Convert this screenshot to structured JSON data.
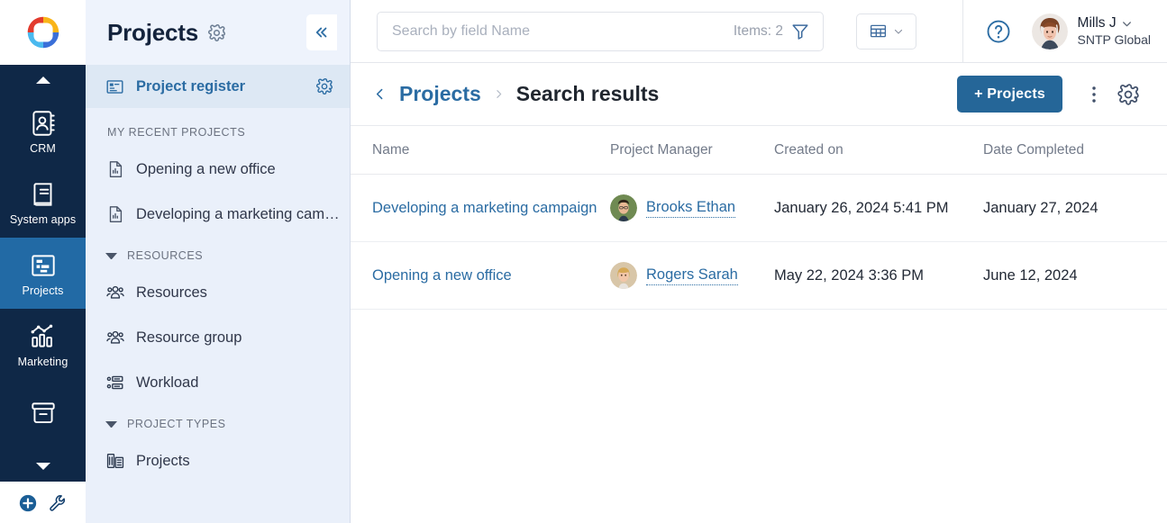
{
  "brand": {
    "logo_icon": "four-color-ring-logo",
    "accent": "#2b6ca3",
    "rail_bg": "#0f2847",
    "rail_active_bg": "#226aa5",
    "sidebar_bg": "#eaf0fa",
    "primary_button_bg": "#256698"
  },
  "rail": {
    "scroll_up_icon": "caret-up-icon",
    "scroll_down_icon": "caret-down-icon",
    "items": [
      {
        "label": "CRM",
        "icon": "contacts-book-icon",
        "active": false
      },
      {
        "label": "System apps",
        "icon": "book-icon",
        "active": false
      },
      {
        "label": "Projects",
        "icon": "project-board-icon",
        "active": true
      },
      {
        "label": "Marketing",
        "icon": "bar-chart-trend-icon",
        "active": false
      },
      {
        "label": "",
        "icon": "archive-box-icon",
        "active": false
      }
    ],
    "footer": [
      {
        "label": "Add",
        "icon": "plus-circle-icon"
      },
      {
        "label": "Tools",
        "icon": "wrench-icon"
      }
    ]
  },
  "sidebar": {
    "title": "Projects",
    "title_gear_icon": "gear-icon",
    "collapse_icon": "chevron-double-left-icon",
    "active_item": {
      "label": "Project register",
      "icon": "project-register-icon",
      "gear_icon": "gear-icon"
    },
    "groups": [
      {
        "label": "MY RECENT PROJECTS",
        "collapsible": false,
        "items": [
          {
            "label": "Opening a new office",
            "icon": "document-chart-icon"
          },
          {
            "label": "Developing a marketing cam…",
            "icon": "document-chart-icon"
          }
        ]
      },
      {
        "label": "RESOURCES",
        "collapsible": true,
        "caret_icon": "caret-down-icon",
        "items": [
          {
            "label": "Resources",
            "icon": "people-group-icon"
          },
          {
            "label": "Resource group",
            "icon": "people-group-icon"
          },
          {
            "label": "Workload",
            "icon": "workload-list-icon"
          }
        ]
      },
      {
        "label": "PROJECT TYPES",
        "collapsible": true,
        "caret_icon": "caret-down-icon",
        "items": [
          {
            "label": "Projects",
            "icon": "building-icon"
          }
        ]
      }
    ]
  },
  "topbar": {
    "search": {
      "placeholder": "Search by field Name",
      "value": "",
      "items_label": "Items: 2",
      "filter_icon": "funnel-icon"
    },
    "view_button": {
      "icon": "table-grid-icon",
      "chevron_icon": "chevron-down-icon"
    },
    "help_icon": "question-circle-icon",
    "user": {
      "name": "Mills J",
      "org": "SNTP Global",
      "avatar_icon": "user-avatar",
      "chevron_icon": "chevron-down-icon"
    }
  },
  "page": {
    "back_icon": "chevron-left-icon",
    "breadcrumb_link": "Projects",
    "breadcrumb_sep_icon": "chevron-right-icon",
    "breadcrumb_current": "Search results",
    "add_button": "+ Projects",
    "kebab_icon": "more-vertical-icon",
    "settings_icon": "gear-icon"
  },
  "table": {
    "columns": [
      "Name",
      "Project Manager",
      "Created on",
      "Date Completed"
    ],
    "rows": [
      {
        "name": "Developing a marketing campaign",
        "manager": "Brooks Ethan",
        "manager_avatar": "user-avatar-male",
        "created_on": "January 26, 2024 5:41 PM",
        "date_completed": "January 27, 2024"
      },
      {
        "name": "Opening a new office",
        "manager": "Rogers Sarah",
        "manager_avatar": "user-avatar-female",
        "created_on": "May 22, 2024 3:36 PM",
        "date_completed": "June 12, 2024"
      }
    ]
  }
}
